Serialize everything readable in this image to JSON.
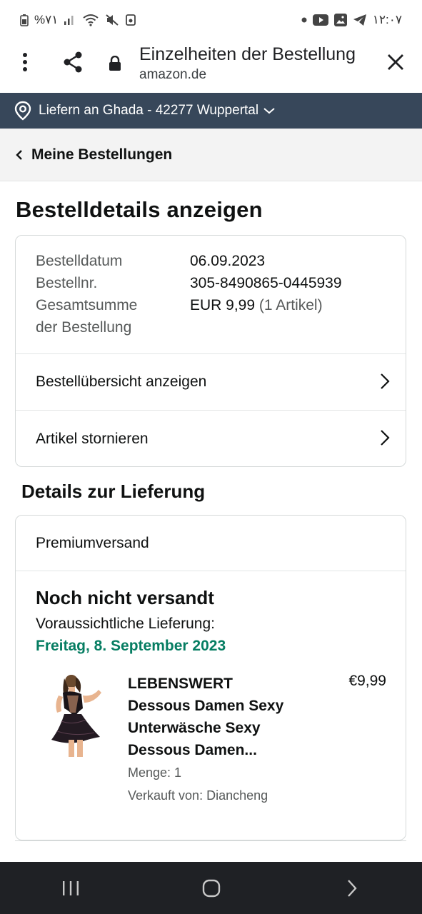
{
  "status_bar": {
    "left_text": "%٧١",
    "time": "١٢:٠٧"
  },
  "browser": {
    "page_title": "Einzelheiten der Bestellung",
    "url": "amazon.de"
  },
  "delivery_bar": {
    "label": "Liefern an Ghada - 42277 Wuppertal"
  },
  "breadcrumb": {
    "label": "Meine Bestellungen"
  },
  "page": {
    "title": "Bestelldetails anzeigen"
  },
  "order_info": {
    "rows": [
      {
        "label": "Bestelldatum",
        "value": "06.09.2023"
      },
      {
        "label": "Bestellnr.",
        "value": "305-8490865-0445939"
      }
    ],
    "total_label_line1": "Gesamtsumme",
    "total_label_line2": "der Bestellung",
    "total_value": "EUR 9,99",
    "total_count": "(1 Artikel)"
  },
  "actions": {
    "view_summary": "Bestellübersicht anzeigen",
    "cancel_items": "Artikel stornieren"
  },
  "delivery": {
    "section_title": "Details zur Lieferung",
    "shipping_type": "Premiumversand",
    "status": "Noch nicht versandt",
    "estimated_label": "Voraussichtliche Lieferung:",
    "estimated_date": "Freitag, 8. September 2023",
    "item": {
      "title_line1": "LEBENSWERT",
      "title_line2": "Dessous Damen Sexy",
      "title_line3": "Unterwäsche Sexy",
      "title_line4": "Dessous Damen...",
      "price": "€9,99",
      "quantity": "Menge: 1",
      "seller": "Verkauft von: Diancheng"
    }
  },
  "colors": {
    "delivery_bar_bg": "#37475a",
    "estimated_date": "#067d62",
    "nav_bar_bg": "#1f2125"
  }
}
